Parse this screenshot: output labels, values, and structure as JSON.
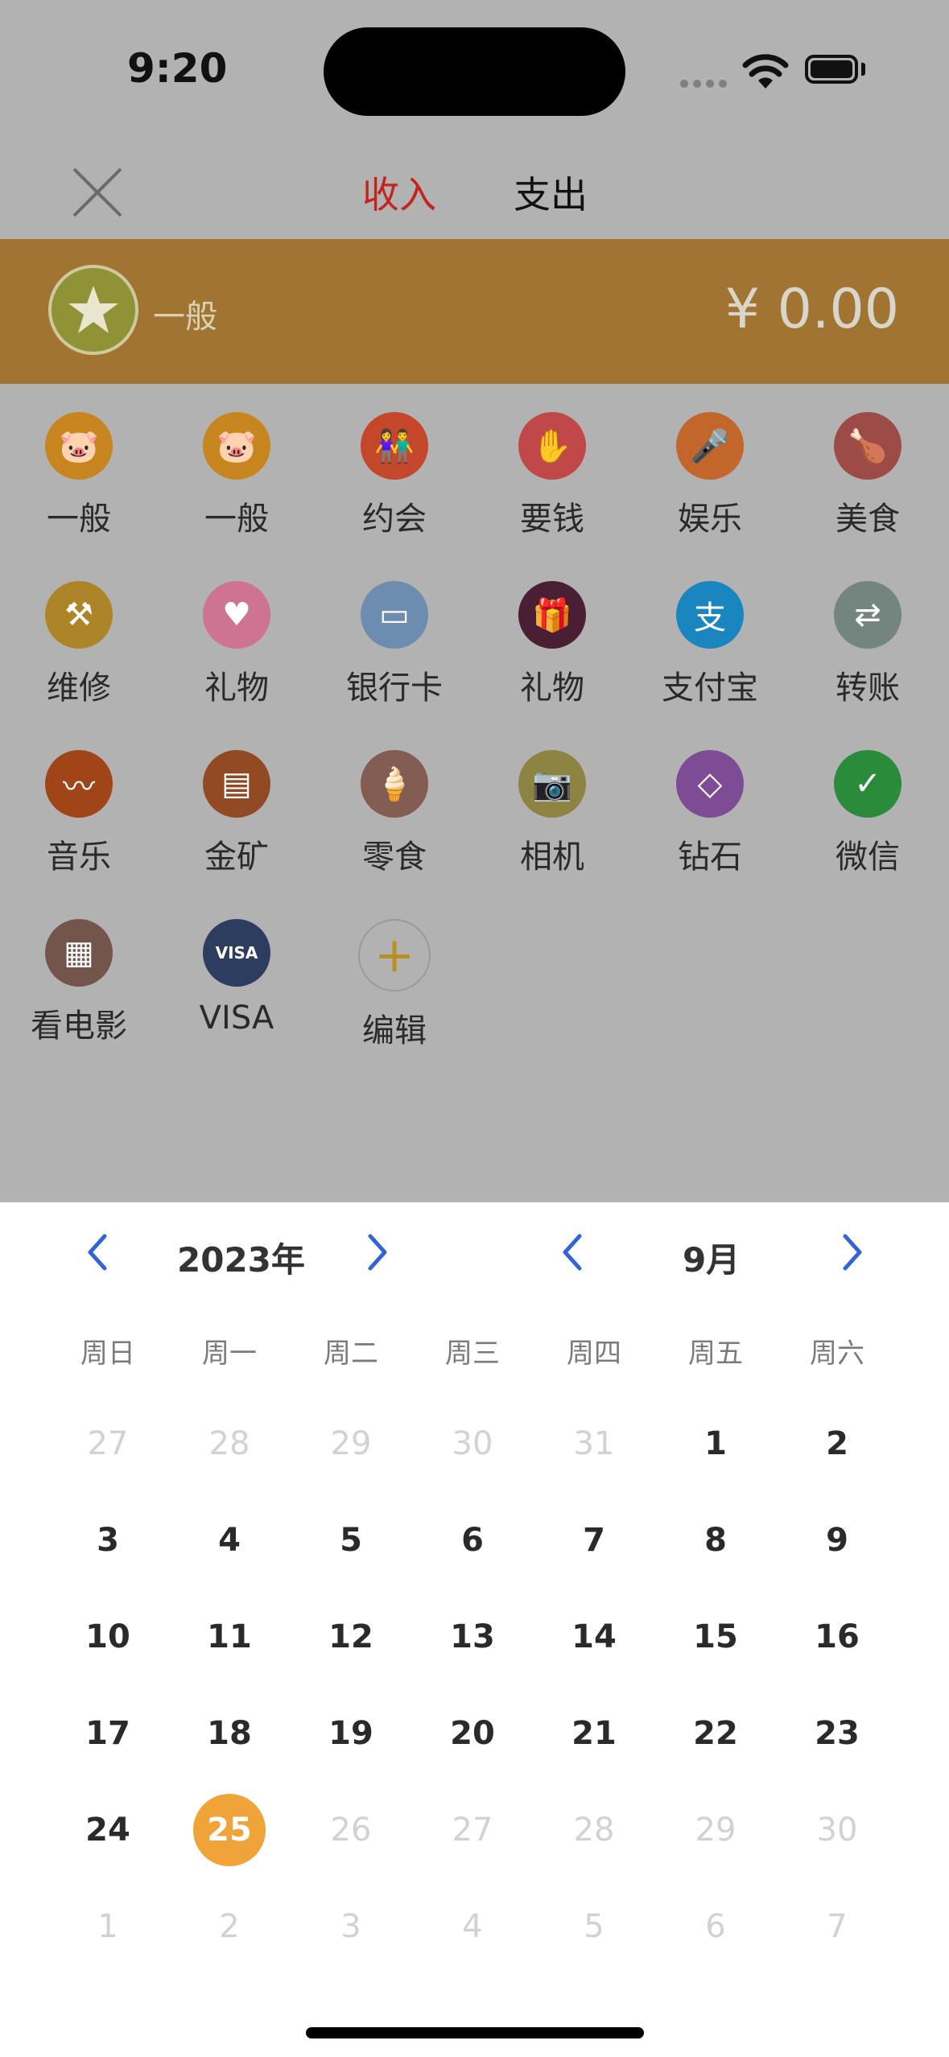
{
  "status_bar": {
    "time": "9:20"
  },
  "header": {
    "tab_income": "收入",
    "tab_expense": "支出",
    "active_tab_color": "#c3241c"
  },
  "selected_category": {
    "label": "一般",
    "amount": "¥ 0.00",
    "icon": "star-icon"
  },
  "categories": [
    {
      "label": "一般",
      "icon": "piggy-bank-icon",
      "color": "#c78520"
    },
    {
      "label": "一般",
      "icon": "piggy-bank-icon",
      "color": "#c78520"
    },
    {
      "label": "约会",
      "icon": "couple-icon",
      "color": "#c5472b"
    },
    {
      "label": "要钱",
      "icon": "hand-icon",
      "color": "#c04848"
    },
    {
      "label": "娱乐",
      "icon": "microphone-icon",
      "color": "#c2662c"
    },
    {
      "label": "美食",
      "icon": "chicken-icon",
      "color": "#9d4b47"
    },
    {
      "label": "维修",
      "icon": "pickaxe-icon",
      "color": "#ad8528"
    },
    {
      "label": "礼物",
      "icon": "heart-icon",
      "color": "#cf7393"
    },
    {
      "label": "银行卡",
      "icon": "bank-card-icon",
      "color": "#6d8db0"
    },
    {
      "label": "礼物",
      "icon": "gift-icon",
      "color": "#4a1f33"
    },
    {
      "label": "支付宝",
      "icon": "alipay-icon",
      "color": "#1a86c0"
    },
    {
      "label": "转账",
      "icon": "transfer-icon",
      "color": "#748580"
    },
    {
      "label": "音乐",
      "icon": "music-wave-icon",
      "color": "#a04518"
    },
    {
      "label": "金矿",
      "icon": "gold-bars-icon",
      "color": "#924a25"
    },
    {
      "label": "零食",
      "icon": "ice-cream-icon",
      "color": "#835c52"
    },
    {
      "label": "相机",
      "icon": "camera-icon",
      "color": "#8d8343"
    },
    {
      "label": "钻石",
      "icon": "diamond-icon",
      "color": "#7e4c94"
    },
    {
      "label": "微信",
      "icon": "wechat-icon",
      "color": "#2a8c3a"
    },
    {
      "label": "看电影",
      "icon": "film-icon",
      "color": "#74554b"
    },
    {
      "label": "VISA",
      "icon": "visa-icon",
      "color": "#2c3d5f"
    },
    {
      "label": "编辑",
      "icon": "plus-icon",
      "color": "transparent"
    }
  ],
  "calendar": {
    "year": "2023年",
    "month": "9月",
    "weekdays": [
      "周日",
      "周一",
      "周二",
      "周三",
      "周四",
      "周五",
      "周六"
    ],
    "weeks": [
      [
        "27",
        "28",
        "29",
        "30",
        "31",
        "1",
        "2"
      ],
      [
        "3",
        "4",
        "5",
        "6",
        "7",
        "8",
        "9"
      ],
      [
        "10",
        "11",
        "12",
        "13",
        "14",
        "15",
        "16"
      ],
      [
        "17",
        "18",
        "19",
        "20",
        "21",
        "22",
        "23"
      ],
      [
        "24",
        "25",
        "26",
        "27",
        "28",
        "29",
        "30"
      ],
      [
        "1",
        "2",
        "3",
        "4",
        "5",
        "6",
        "7"
      ]
    ],
    "selected_day": "25",
    "selected_color": "#f0a338"
  }
}
